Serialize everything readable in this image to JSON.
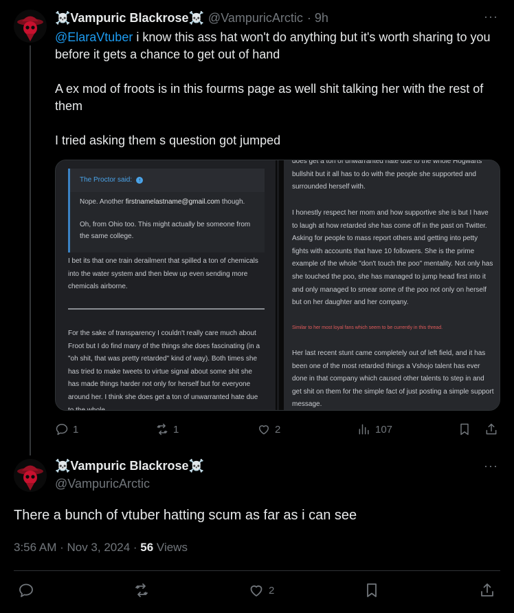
{
  "reply": {
    "display_name": "☠️Vampuric Blackrose☠️",
    "handle": "@VampuricArctic",
    "time": "· 9h",
    "more": "···",
    "mention": "@ElaraVtuber",
    "text_1": " i know this ass hat won't do anything but it's worth sharing to you before it gets a chance to get out of hand",
    "text_2": "A ex mod of froots is in this fourms page as well shit talking her with the rest of them",
    "text_3": "I tried asking them s question got jumped",
    "actions": {
      "replies": "1",
      "reposts": "1",
      "likes": "2",
      "views": "107"
    },
    "media": {
      "left": {
        "quote_header": "The Proctor said:",
        "quote_line_1_pre": "Nope. Another ",
        "quote_email": "firstnamelastname@gmail.com",
        "quote_line_1_post": " though.",
        "quote_line_2": "Oh, from Ohio too. This might actually be someone from the same college.",
        "para_1": "I bet its that one train derailment that spilled a ton of chemicals into the water system and then blew up even sending more chemicals airborne.",
        "para_2": "For the sake of transparency I couldn't really care much about Froot but I do find many of the things she does fascinating (in a \"oh shit, that was pretty retarded\" kind of way). Both times she has tried to make tweets to virtue signal about some shit she has made things harder not only for herself but for everyone around her. I think she does get a ton of unwarranted hate due to the whole"
      },
      "right": {
        "para_1": "does get a ton of unwarranted hate due to the whole Hogwarts bullshit but it all has to do with the people she supported and surrounded herself with.",
        "para_2": "I honestly respect her mom and how supportive she is but I have to laugh at how retarded she has come off in the past on Twitter. Asking for people to mass report others and getting into petty fights with accounts that have 10 followers. She is the prime example of the whole \"don't touch the poo\" mentality. Not only has she touched the poo, she has managed to jump head first into it and only managed to smear some of the poo not only on herself but on her daughter and her company.",
        "red_note": "Similar to her most loyal fans which seem to be currently in this thread.",
        "para_3": "Her last recent stunt came completely out of left field, and it has been one of the most retarded things a Vshojo talent has ever done in that company which caused other talents to step in and get shit on them for the simple fact of just posting a simple support message."
      }
    }
  },
  "main": {
    "display_name": "☠️Vampuric Blackrose☠️",
    "handle": "@VampuricArctic",
    "more": "···",
    "text": "There a bunch of vtuber hatting scum as far as i can see",
    "timestamp": "3:56 AM · Nov 3, 2024 · ",
    "views_count": "56",
    "views_label": " Views",
    "actions": {
      "likes": "2"
    }
  },
  "colors": {
    "background": "#000000",
    "text": "#e7e9ea",
    "muted": "#71767b",
    "link": "#1d9bf0",
    "avatar_red": "#c8102e"
  }
}
